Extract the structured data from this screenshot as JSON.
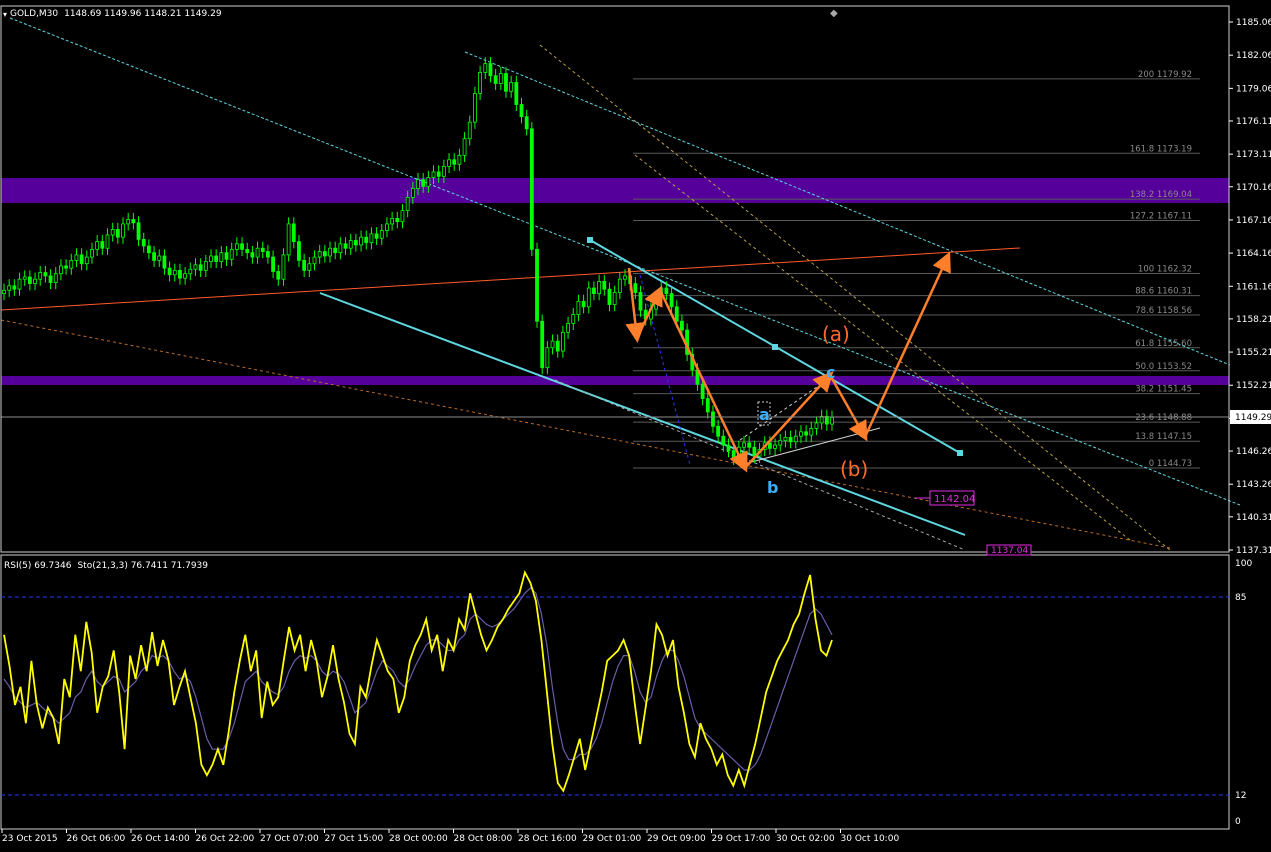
{
  "window": {
    "title": "GOLD,M30",
    "ohlc": "1148.69 1149.96 1148.21 1149.29"
  },
  "indicator": {
    "title": "RSI(5) 69.7346",
    "stoch": "Sto(21,3,3) 76.7411 71.7939",
    "levels": [
      "100",
      "85",
      "12",
      "0"
    ]
  },
  "price_axis": {
    "ticks": [
      "1185.06",
      "1182.06",
      "1179.06",
      "1176.11",
      "1173.11",
      "1170.16",
      "1167.16",
      "1164.16",
      "1161.16",
      "1158.21",
      "1155.21",
      "1152.21",
      "1149.21",
      "1146.26",
      "1143.26",
      "1140.31",
      "1137.31"
    ],
    "current_price": "1149.29"
  },
  "time_axis": {
    "ticks": [
      "23 Oct 2015",
      "26 Oct 06:00",
      "26 Oct 14:00",
      "26 Oct 22:00",
      "27 Oct 07:00",
      "27 Oct 15:00",
      "28 Oct 00:00",
      "28 Oct 08:00",
      "28 Oct 16:00",
      "29 Oct 01:00",
      "29 Oct 09:00",
      "29 Oct 17:00",
      "30 Oct 02:00",
      "30 Oct 10:00"
    ]
  },
  "fib_levels": [
    {
      "label": "200 1179.92"
    },
    {
      "label": "161.8 1173.19"
    },
    {
      "label": "138.2 1169.04"
    },
    {
      "label": "127.2 1167.11"
    },
    {
      "label": "100 1162.32"
    },
    {
      "label": "88.6 1160.31"
    },
    {
      "label": "78.6 1158.56"
    },
    {
      "label": "61.8 1155.60"
    },
    {
      "label": "50.0 1153.52"
    },
    {
      "label": "38.2 1151.45"
    },
    {
      "label": "23.6 1148.88"
    },
    {
      "label": "13.8 1147.15"
    },
    {
      "label": "0 1144.73"
    }
  ],
  "price_tags": {
    "tag1": "1142.04",
    "tag2": "1137.04"
  },
  "wave_labels": {
    "a_orange": "(a)",
    "b_orange": "(b)",
    "a_blue": "a",
    "b_blue": "b",
    "c_blue": "c"
  },
  "colors": {
    "bull": "#00ff00",
    "zone": "#55009a",
    "channel": "#5ed7e0",
    "projection": "#ff7f2a",
    "rsi": "#ffff00",
    "stoch": "#6b5ca8"
  },
  "chart_data": {
    "type": "candlestick",
    "symbol": "GOLD",
    "timeframe": "M30",
    "ylim": [
      1137.31,
      1185.06
    ],
    "close_series": [
      1160.8,
      1161.2,
      1160.9,
      1161.8,
      1162.0,
      1161.4,
      1161.8,
      1162.4,
      1162.1,
      1161.5,
      1162.3,
      1163.0,
      1162.8,
      1163.5,
      1164.0,
      1163.2,
      1163.8,
      1164.5,
      1165.2,
      1164.6,
      1165.8,
      1166.3,
      1165.6,
      1166.8,
      1167.2,
      1166.9,
      1165.4,
      1164.8,
      1164.2,
      1163.5,
      1163.9,
      1162.8,
      1162.2,
      1162.6,
      1161.9,
      1162.3,
      1162.7,
      1163.1,
      1162.6,
      1163.4,
      1163.9,
      1163.4,
      1164.2,
      1163.6,
      1164.5,
      1165.0,
      1164.5,
      1164.2,
      1163.8,
      1164.6,
      1164.3,
      1163.8,
      1162.5,
      1161.8,
      1164.0,
      1166.8,
      1165.2,
      1163.5,
      1162.6,
      1163.2,
      1163.8,
      1164.3,
      1163.9,
      1164.6,
      1164.2,
      1165.0,
      1164.6,
      1165.3,
      1164.9,
      1165.6,
      1165.1,
      1165.9,
      1165.5,
      1166.2,
      1166.8,
      1167.3,
      1167.0,
      1168.0,
      1169.2,
      1170.0,
      1170.8,
      1170.2,
      1171.0,
      1171.5,
      1171.1,
      1172.0,
      1172.6,
      1172.2,
      1173.0,
      1174.5,
      1176.0,
      1178.6,
      1180.5,
      1181.3,
      1180.2,
      1179.5,
      1180.4,
      1178.8,
      1179.6,
      1177.6,
      1176.5,
      1175.4,
      1164.5,
      1158.0,
      1153.8,
      1155.6,
      1156.2,
      1155.3,
      1157.0,
      1157.8,
      1158.6,
      1159.8,
      1159.3,
      1161.0,
      1160.5,
      1161.6,
      1160.9,
      1159.5,
      1160.6,
      1161.8,
      1162.1,
      1161.4,
      1160.6,
      1159.0,
      1158.2,
      1159.1,
      1160.2,
      1161.0,
      1160.5,
      1159.3,
      1158.0,
      1157.2,
      1155.0,
      1153.6,
      1152.3,
      1151.0,
      1149.8,
      1148.5,
      1147.6,
      1146.8,
      1146.3,
      1145.6,
      1146.6,
      1147.0,
      1146.6,
      1145.8,
      1146.4,
      1147.0,
      1146.5,
      1146.8,
      1147.2,
      1147.5,
      1147.1,
      1147.6,
      1148.0,
      1147.7,
      1148.3,
      1148.8,
      1149.4,
      1148.7,
      1149.3
    ],
    "rsi_series": [
      72,
      60,
      45,
      52,
      38,
      62,
      45,
      36,
      44,
      40,
      30,
      55,
      48,
      72,
      58,
      77,
      65,
      42,
      52,
      56,
      66,
      50,
      28,
      64,
      55,
      68,
      58,
      73,
      60,
      70,
      62,
      45,
      52,
      58,
      48,
      38,
      22,
      18,
      22,
      28,
      22,
      35,
      50,
      62,
      72,
      58,
      66,
      40,
      54,
      45,
      48,
      62,
      75,
      66,
      72,
      58,
      70,
      62,
      48,
      56,
      68,
      55,
      46,
      34,
      30,
      52,
      48,
      60,
      70,
      64,
      58,
      55,
      42,
      48,
      62,
      68,
      72,
      78,
      66,
      72,
      58,
      70,
      66,
      78,
      74,
      88,
      80,
      72,
      66,
      70,
      75,
      78,
      82,
      85,
      88,
      96,
      92,
      85,
      70,
      50,
      30,
      15,
      12,
      18,
      25,
      32,
      20,
      30,
      40,
      50,
      62,
      64,
      66,
      70,
      64,
      46,
      30,
      44,
      58,
      76,
      72,
      64,
      70,
      52,
      42,
      30,
      25,
      38,
      32,
      28,
      22,
      26,
      18,
      14,
      20,
      14,
      22,
      30,
      40,
      50,
      56,
      62,
      66,
      70,
      76,
      80,
      88,
      95,
      78,
      66,
      64,
      70
    ],
    "stoch_series": [
      55,
      52,
      48,
      46,
      44,
      45,
      46,
      44,
      42,
      40,
      38,
      40,
      42,
      48,
      50,
      55,
      58,
      54,
      52,
      54,
      56,
      55,
      50,
      52,
      54,
      58,
      60,
      64,
      63,
      64,
      62,
      58,
      55,
      56,
      54,
      48,
      40,
      32,
      28,
      28,
      28,
      32,
      38,
      46,
      54,
      56,
      58,
      54,
      52,
      50,
      49,
      52,
      58,
      62,
      64,
      63,
      64,
      62,
      58,
      56,
      58,
      57,
      54,
      48,
      42,
      44,
      46,
      52,
      58,
      62,
      60,
      58,
      54,
      52,
      55,
      60,
      64,
      68,
      70,
      70,
      68,
      66,
      66,
      70,
      72,
      78,
      80,
      78,
      76,
      75,
      76,
      78,
      80,
      82,
      85,
      88,
      90,
      88,
      80,
      68,
      52,
      38,
      28,
      24,
      24,
      26,
      26,
      28,
      32,
      38,
      46,
      54,
      60,
      64,
      64,
      58,
      50,
      46,
      48,
      56,
      62,
      66,
      66,
      62,
      56,
      48,
      40,
      36,
      34,
      32,
      30,
      28,
      26,
      24,
      22,
      20,
      20,
      22,
      26,
      32,
      38,
      44,
      50,
      56,
      62,
      68,
      74,
      80,
      82,
      80,
      76,
      72
    ]
  }
}
